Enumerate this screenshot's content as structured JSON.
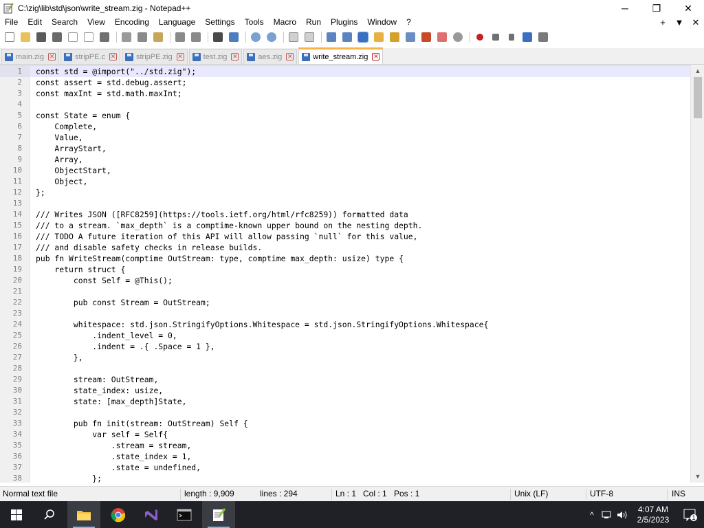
{
  "window": {
    "title": "C:\\zig\\lib\\std\\json\\write_stream.zig - Notepad++",
    "minimize": "─",
    "maximize": "❐",
    "close": "✕"
  },
  "menu": {
    "items": [
      "File",
      "Edit",
      "Search",
      "View",
      "Encoding",
      "Language",
      "Settings",
      "Tools",
      "Macro",
      "Run",
      "Plugins",
      "Window",
      "?"
    ],
    "add_label": "+",
    "dropdown_label": "▼",
    "close_label": "✕"
  },
  "tabs": [
    {
      "label": "main.zig",
      "active": false
    },
    {
      "label": "stripPE.c",
      "active": false
    },
    {
      "label": "stripPE.zig",
      "active": false
    },
    {
      "label": "test.zig",
      "active": false
    },
    {
      "label": "aes.zig",
      "active": false
    },
    {
      "label": "write_stream.zig",
      "active": true
    }
  ],
  "editor": {
    "current_line": 1,
    "lines": [
      {
        "n": "1",
        "code": "const std = @import(\"../std.zig\");"
      },
      {
        "n": "2",
        "code": "const assert = std.debug.assert;"
      },
      {
        "n": "3",
        "code": "const maxInt = std.math.maxInt;"
      },
      {
        "n": "4",
        "code": ""
      },
      {
        "n": "5",
        "code": "const State = enum {"
      },
      {
        "n": "6",
        "code": "    Complete,"
      },
      {
        "n": "7",
        "code": "    Value,"
      },
      {
        "n": "8",
        "code": "    ArrayStart,"
      },
      {
        "n": "9",
        "code": "    Array,"
      },
      {
        "n": "10",
        "code": "    ObjectStart,"
      },
      {
        "n": "11",
        "code": "    Object,"
      },
      {
        "n": "12",
        "code": "};"
      },
      {
        "n": "13",
        "code": ""
      },
      {
        "n": "14",
        "code": "/// Writes JSON ([RFC8259](https://tools.ietf.org/html/rfc8259)) formatted data"
      },
      {
        "n": "15",
        "code": "/// to a stream. `max_depth` is a comptime-known upper bound on the nesting depth."
      },
      {
        "n": "16",
        "code": "/// TODO A future iteration of this API will allow passing `null` for this value,"
      },
      {
        "n": "17",
        "code": "/// and disable safety checks in release builds."
      },
      {
        "n": "18",
        "code": "pub fn WriteStream(comptime OutStream: type, comptime max_depth: usize) type {"
      },
      {
        "n": "19",
        "code": "    return struct {"
      },
      {
        "n": "20",
        "code": "        const Self = @This();"
      },
      {
        "n": "21",
        "code": ""
      },
      {
        "n": "22",
        "code": "        pub const Stream = OutStream;"
      },
      {
        "n": "23",
        "code": ""
      },
      {
        "n": "24",
        "code": "        whitespace: std.json.StringifyOptions.Whitespace = std.json.StringifyOptions.Whitespace{"
      },
      {
        "n": "25",
        "code": "            .indent_level = 0,"
      },
      {
        "n": "26",
        "code": "            .indent = .{ .Space = 1 },"
      },
      {
        "n": "27",
        "code": "        },"
      },
      {
        "n": "28",
        "code": ""
      },
      {
        "n": "29",
        "code": "        stream: OutStream,"
      },
      {
        "n": "30",
        "code": "        state_index: usize,"
      },
      {
        "n": "31",
        "code": "        state: [max_depth]State,"
      },
      {
        "n": "32",
        "code": ""
      },
      {
        "n": "33",
        "code": "        pub fn init(stream: OutStream) Self {"
      },
      {
        "n": "34",
        "code": "            var self = Self{"
      },
      {
        "n": "35",
        "code": "                .stream = stream,"
      },
      {
        "n": "36",
        "code": "                .state_index = 1,"
      },
      {
        "n": "37",
        "code": "                .state = undefined,"
      },
      {
        "n": "38",
        "code": "            };"
      }
    ]
  },
  "scrollbar": {
    "up": "▲",
    "down": "▼"
  },
  "status": {
    "file_type": "Normal text file",
    "length": "length : 9,909",
    "lines": "lines : 294",
    "ln": "Ln : 1",
    "col": "Col : 1",
    "pos": "Pos : 1",
    "eol": "Unix (LF)",
    "encoding": "UTF-8",
    "mode": "INS"
  },
  "taskbar": {
    "time": "4:07 AM",
    "date": "2/5/2023",
    "notification_count": "1",
    "chevron": "^"
  }
}
